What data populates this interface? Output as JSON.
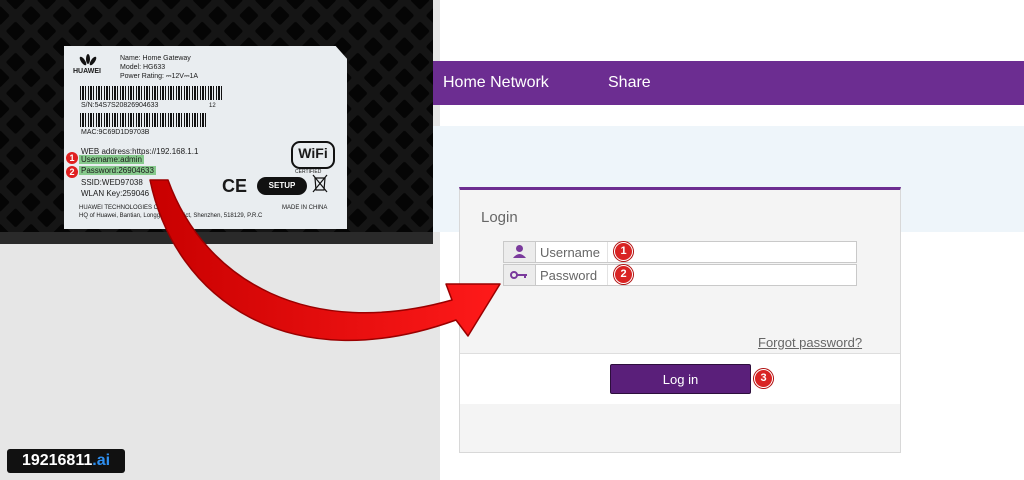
{
  "router_label": {
    "brand": "HUAWEI",
    "name_line": "Name: Home Gateway",
    "model_line": "Model: HG633",
    "power_line": "Power Rating: ⎓12V⎓1A",
    "serial_line": "S/N:54S7S20826904633",
    "serial_suffix": "12",
    "mac_line": "MAC:9C69D1D9703B",
    "web_address_line": "WEB address:https://192.168.1.1",
    "username_line": "Username:admin",
    "password_line": "Password:26904633",
    "ssid_line": "SSID:WED97038",
    "wlan_key_line": "WLAN Key:259046",
    "wifi_logo": "WiFi",
    "wifi_certified": "CERTIFIED",
    "ce_mark": "CE",
    "setup_logo": "SETUP",
    "manufacturer_line": "HUAWEI TECHNOLOGIES CO., LTD.",
    "address_line": "HQ of Huawei, Bantian, Longgang District, Shenzhen, 518129, P.R.C",
    "made_in": "MADE IN CHINA",
    "markers": [
      "1",
      "2"
    ]
  },
  "watermark": {
    "main": "19216811",
    "suffix": ".ai"
  },
  "navbar": {
    "items": [
      "Home Network",
      "Share"
    ],
    "color": "#6c2d91"
  },
  "login": {
    "title": "Login",
    "username_placeholder": "Username",
    "password_placeholder": "Password",
    "forgot_link": "Forgot password?",
    "button_label": "Log in",
    "step_markers": [
      "1",
      "2",
      "3"
    ],
    "button_color": "#5a1f7a"
  },
  "icons": {
    "username": "user-icon",
    "password": "key-icon",
    "arrow": "curved-arrow"
  }
}
